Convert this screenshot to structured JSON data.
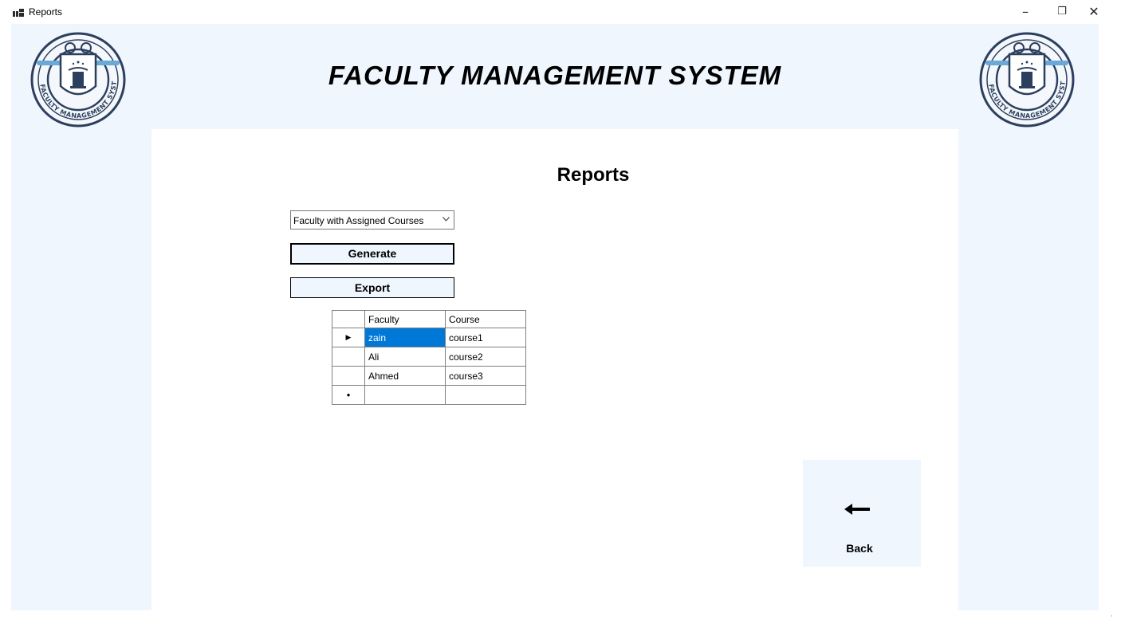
{
  "window": {
    "title": "Reports",
    "controls": {
      "minimize": "–",
      "restore": "❐",
      "close": "✕"
    }
  },
  "header": {
    "title": "FACULTY MANAGEMENT SYSTEM",
    "logo_icon": "faculty-management-seal-icon",
    "logo_text": "FACULTY MANAGEMENT SYSTEM"
  },
  "main": {
    "heading": "Reports",
    "report_select": {
      "value": "Faculty with Assigned Courses"
    },
    "generate_label": "Generate",
    "export_label": "Export",
    "grid": {
      "columns": [
        "Faculty",
        "Course"
      ],
      "rows": [
        {
          "faculty": "zain",
          "course": "course1"
        },
        {
          "faculty": "Ali",
          "course": "course2"
        },
        {
          "faculty": "Ahmed",
          "course": "course3"
        }
      ],
      "current_row_marker": "▶",
      "new_row_marker": "●"
    },
    "back_label": "Back"
  },
  "colors": {
    "panel": "#eff6fe",
    "selection": "#0078d7"
  }
}
